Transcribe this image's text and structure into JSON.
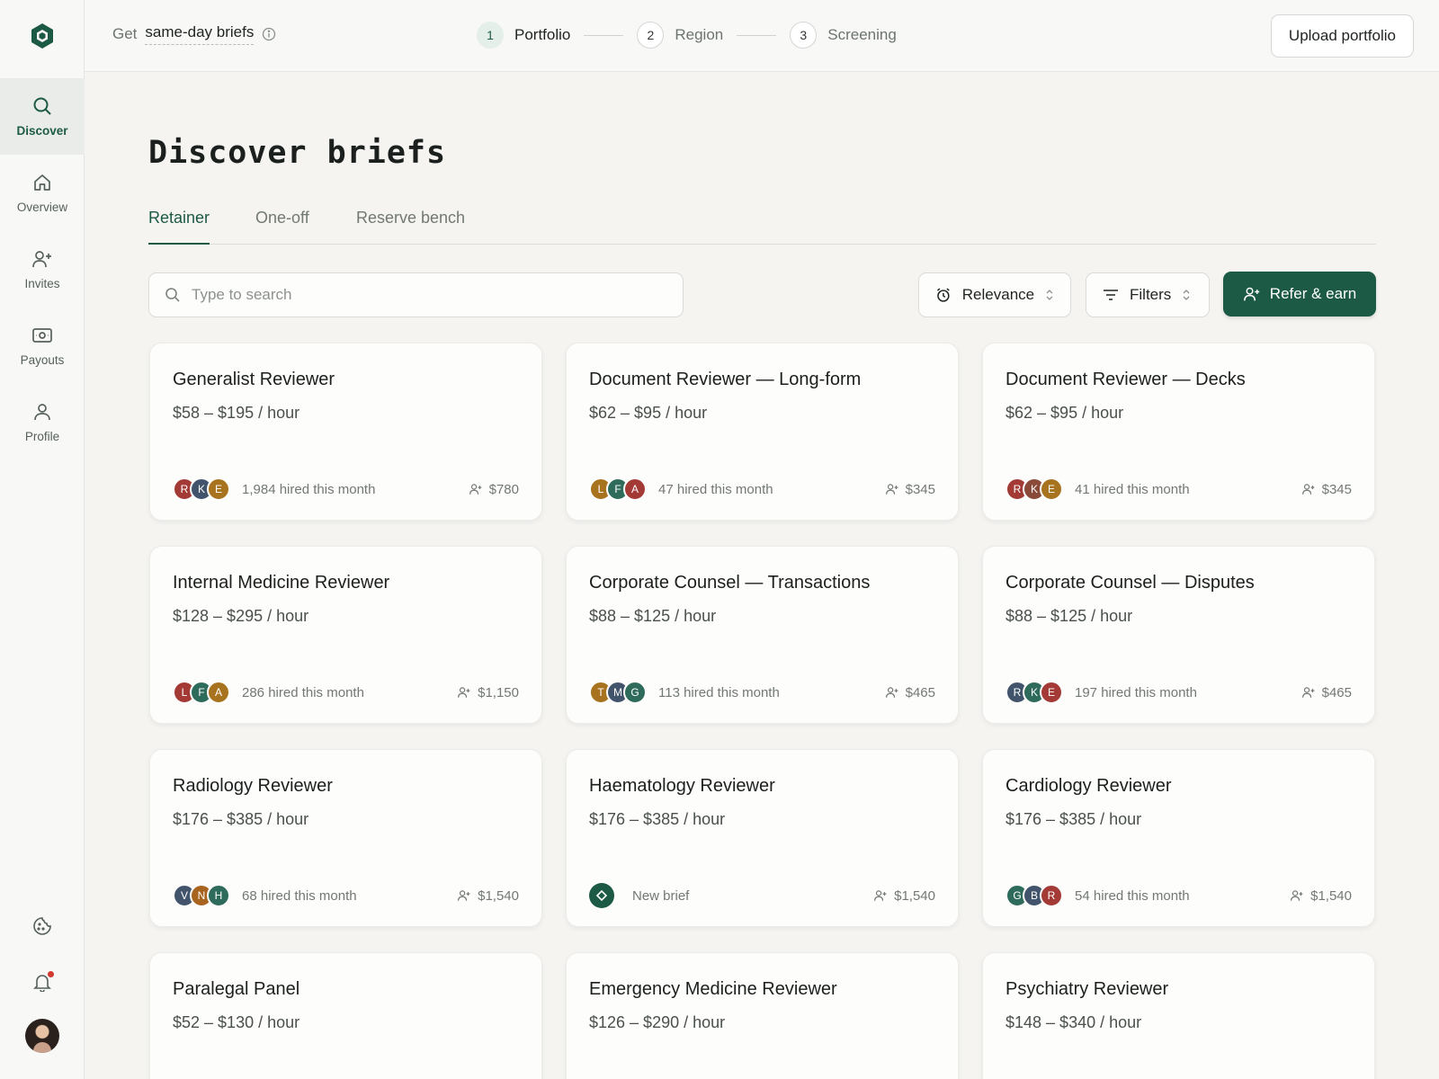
{
  "topbar": {
    "get_prefix": "Get",
    "get_link": "same-day briefs",
    "steps": [
      {
        "num": "1",
        "label": "Portfolio"
      },
      {
        "num": "2",
        "label": "Region"
      },
      {
        "num": "3",
        "label": "Screening"
      }
    ],
    "upload_label": "Upload portfolio"
  },
  "sidebar": {
    "items": [
      {
        "label": "Discover",
        "icon": "search-icon"
      },
      {
        "label": "Overview",
        "icon": "home-icon"
      },
      {
        "label": "Invites",
        "icon": "user-plus-icon"
      },
      {
        "label": "Payouts",
        "icon": "banknote-icon"
      },
      {
        "label": "Profile",
        "icon": "user-icon"
      }
    ]
  },
  "page": {
    "title": "Discover briefs"
  },
  "tabs": [
    "Retainer",
    "One-off",
    "Reserve bench"
  ],
  "search": {
    "placeholder": "Type to search"
  },
  "controls": {
    "sort_label": "Relevance",
    "filters_label": "Filters",
    "refer_label": "Refer & earn"
  },
  "colors": {
    "accent": "#1d5a46",
    "background": "#f5f4f1",
    "card": "#fdfdfc"
  },
  "cards": [
    {
      "title": "Generalist Reviewer",
      "rate": "$58 – $195 / hour",
      "avatars": [
        {
          "l": "R",
          "c": "#a33a36"
        },
        {
          "l": "K",
          "c": "#41546b"
        },
        {
          "l": "E",
          "c": "#a8731f"
        }
      ],
      "hired": "1,984 hired this month",
      "bonus": "$780"
    },
    {
      "title": "Document Reviewer — Long-form",
      "rate": "$62 – $95 / hour",
      "avatars": [
        {
          "l": "L",
          "c": "#a8731f"
        },
        {
          "l": "F",
          "c": "#2e6b5b"
        },
        {
          "l": "A",
          "c": "#a33a36"
        }
      ],
      "hired": "47 hired this month",
      "bonus": "$345"
    },
    {
      "title": "Document Reviewer — Decks",
      "rate": "$62 – $95 / hour",
      "avatars": [
        {
          "l": "R",
          "c": "#a33a36"
        },
        {
          "l": "K",
          "c": "#8a4a3a"
        },
        {
          "l": "E",
          "c": "#a8731f"
        }
      ],
      "hired": "41 hired this month",
      "bonus": "$345"
    },
    {
      "title": "Internal Medicine Reviewer",
      "rate": "$128 – $295 / hour",
      "avatars": [
        {
          "l": "L",
          "c": "#a33a36"
        },
        {
          "l": "F",
          "c": "#2e6b5b"
        },
        {
          "l": "A",
          "c": "#a8731f"
        }
      ],
      "hired": "286 hired this month",
      "bonus": "$1,150"
    },
    {
      "title": "Corporate Counsel — Transactions",
      "rate": "$88 – $125 / hour",
      "avatars": [
        {
          "l": "T",
          "c": "#a8731f"
        },
        {
          "l": "M",
          "c": "#41546b"
        },
        {
          "l": "G",
          "c": "#2e6b5b"
        }
      ],
      "hired": "113 hired this month",
      "bonus": "$465"
    },
    {
      "title": "Corporate Counsel — Disputes",
      "rate": "$88 – $125 / hour",
      "avatars": [
        {
          "l": "R",
          "c": "#41546b"
        },
        {
          "l": "K",
          "c": "#2e6b5b"
        },
        {
          "l": "E",
          "c": "#a33a36"
        }
      ],
      "hired": "197 hired this month",
      "bonus": "$465"
    },
    {
      "title": "Radiology Reviewer",
      "rate": "$176 – $385 / hour",
      "avatars": [
        {
          "l": "V",
          "c": "#41546b"
        },
        {
          "l": "N",
          "c": "#a8631f"
        },
        {
          "l": "H",
          "c": "#2e6b5b"
        }
      ],
      "hired": "68 hired this month",
      "bonus": "$1,540"
    },
    {
      "title": "Haematology Reviewer",
      "rate": "$176 – $385 / hour",
      "avatars": [],
      "hired": "New brief",
      "bonus": "$1,540"
    },
    {
      "title": "Cardiology Reviewer",
      "rate": "$176 – $385 / hour",
      "avatars": [
        {
          "l": "G",
          "c": "#2e6b5b"
        },
        {
          "l": "B",
          "c": "#41546b"
        },
        {
          "l": "R",
          "c": "#a33a36"
        }
      ],
      "hired": "54 hired this month",
      "bonus": "$1,540"
    },
    {
      "title": "Paralegal Panel",
      "rate": "$52 – $130 / hour"
    },
    {
      "title": "Emergency Medicine Reviewer",
      "rate": "$126 – $290 / hour"
    },
    {
      "title": "Psychiatry Reviewer",
      "rate": "$148 – $340 / hour"
    }
  ]
}
